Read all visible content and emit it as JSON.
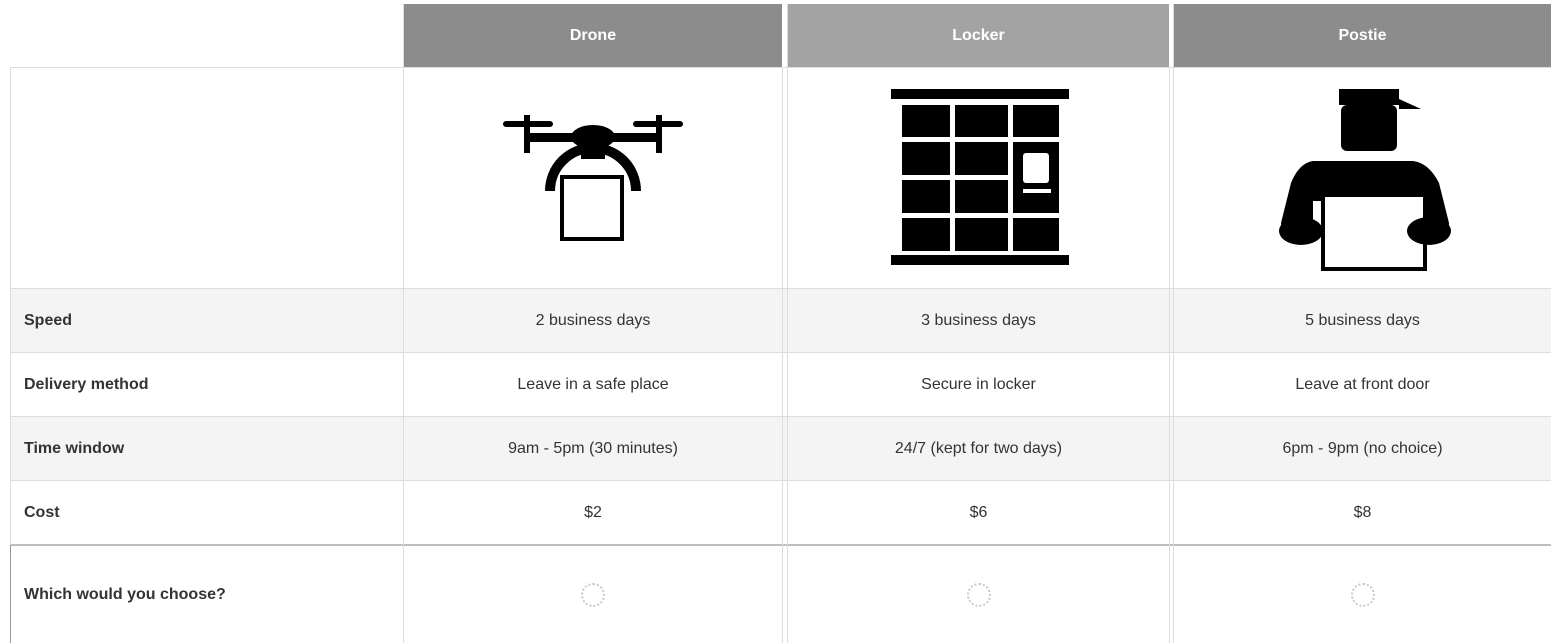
{
  "columns": [
    {
      "name": "Drone",
      "icon": "drone-icon"
    },
    {
      "name": "Locker",
      "icon": "parcel-locker-icon"
    },
    {
      "name": "Postie",
      "icon": "postman-icon"
    }
  ],
  "rows": [
    {
      "label": "Speed",
      "values": [
        "2 business days",
        "3 business days",
        "5 business days"
      ]
    },
    {
      "label": "Delivery method",
      "values": [
        "Leave in a safe place",
        "Secure in locker",
        "Leave at front door"
      ]
    },
    {
      "label": "Time window",
      "values": [
        "9am - 5pm (30 minutes)",
        "24/7 (kept for two days)",
        "6pm - 9pm (no choice)"
      ]
    },
    {
      "label": "Cost",
      "values": [
        "$2",
        "$6",
        "$8"
      ]
    }
  ],
  "choice": {
    "label": "Which would you choose?",
    "selected": null
  }
}
